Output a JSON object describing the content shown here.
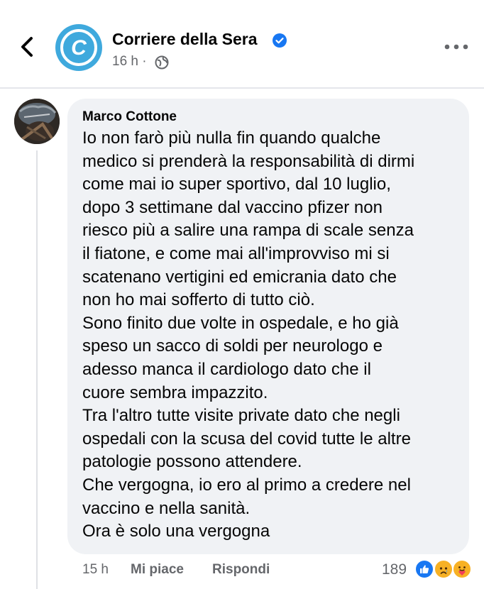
{
  "header": {
    "page_name": "Corriere della Sera",
    "time": "16 h ·",
    "avatar_letter": "C",
    "back_icon": "chevron-left-icon",
    "more_icon": "more-horizontal-icon",
    "verified_icon": "verified-badge-icon",
    "privacy_icon": "globe-icon"
  },
  "comment": {
    "author": "Marco Cottone",
    "text": "Io non farò più nulla fin quando qualche\nmedico si prenderà la responsabilità di dirmi\ncome mai io super sportivo, dal 10 luglio,\ndopo 3 settimane dal vaccino pfizer non\nriesco più a salire una rampa di scale senza\nil fiatone, e come mai all'improvviso mi si\nscatenano vertigini ed emicrania dato che\nnon ho mai sofferto di tutto ciò.\nSono finito due volte in ospedale, e ho già\nspeso un sacco di soldi per neurologo e\nadesso manca il cardiologo dato che il\ncuore sembra impazzito.\nTra l'altro tutte visite private dato che negli\nospedali con la scusa del covid tutte le altre\npatologie possono attendere.\nChe vergogna, io ero al primo a credere nel\nvaccino e nella sanità.\nOra è solo una vergogna",
    "time": "15 h",
    "like_label": "Mi piace",
    "reply_label": "Rispondi",
    "reaction_count": "189",
    "reactions": [
      "like-reaction-icon",
      "sad-reaction-icon",
      "care-reaction-icon"
    ]
  },
  "colors": {
    "brand": "#3fa9dd",
    "verified": "#1877f2",
    "bubble": "#f0f2f5",
    "secondary_text": "#65676b"
  }
}
